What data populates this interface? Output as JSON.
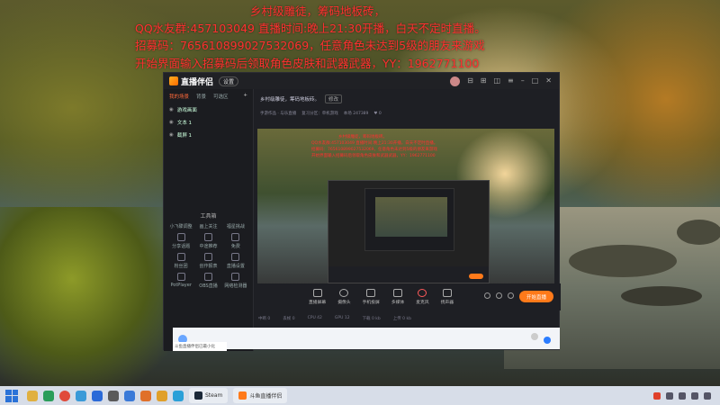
{
  "overlay": {
    "line1": "乡村级雕徒，筹码地板砖，",
    "line2": "QQ水友群:457103049  直播时间:晚上21:30开播，白天不定时直播。",
    "line3": "招募码：765610899027532069，任意角色未达到5级的朋友来游戏",
    "line4": "开始界面输入招募码后领取角色皮肤和武器武器，YY：1962771100"
  },
  "app": {
    "name": "直播伴侣",
    "badge": "设置",
    "window_controls": [
      "⊟",
      "⊞",
      "◫",
      "≡",
      "–",
      "□",
      "✕"
    ]
  },
  "left_panel": {
    "tabs": [
      "我的场景",
      "背景",
      "可选区"
    ],
    "active_tab": 0,
    "layers": [
      "游戏画面",
      "文本 1",
      "截屏 1"
    ],
    "tools_title": "工具箱",
    "tools": [
      "小飞碟调整",
      "画上关注",
      "福星挑战",
      "分享话题",
      "中途推荐",
      "免费",
      "粉丝团",
      "创作报表",
      "直播设置",
      "PotPlayer",
      "OBS直播",
      "网络检测器"
    ]
  },
  "scene": {
    "title": "乡村级雕徒，筹码地板砖。",
    "btn": "修改",
    "subbar": [
      "手游作品 · 与乐直播",
      "复习分区：单机游戏",
      "本场 247389",
      "♥ 0"
    ]
  },
  "preview": {
    "red_lines": [
      "乡村级雕徒，筹码地板砖。",
      "QQ水友群:457103049 直播时间:晚上21:30开播，白天不定时直播。",
      "招募码：765610899027532069，任意角色未达到5级的朋友来游戏",
      "开始界面输入招募码后领取角色皮肤和武器武器，YY：1962771100"
    ]
  },
  "controls": {
    "buttons": [
      "直播屏幕",
      "摄像头",
      "手机投屏",
      "多媒体",
      "麦克风",
      "扬声器"
    ],
    "live_label": "开始直播"
  },
  "status": [
    "中断 0",
    "丢帧 0",
    "CPU 42",
    "GPU 12",
    "下载 0 kb",
    "上传 0 kb"
  ],
  "taskbar": {
    "tasks": [
      {
        "label": "Steam"
      },
      {
        "label": "斗鱼直播伴侣"
      }
    ]
  },
  "tip": "斗鱼直播伴侣已最小化"
}
